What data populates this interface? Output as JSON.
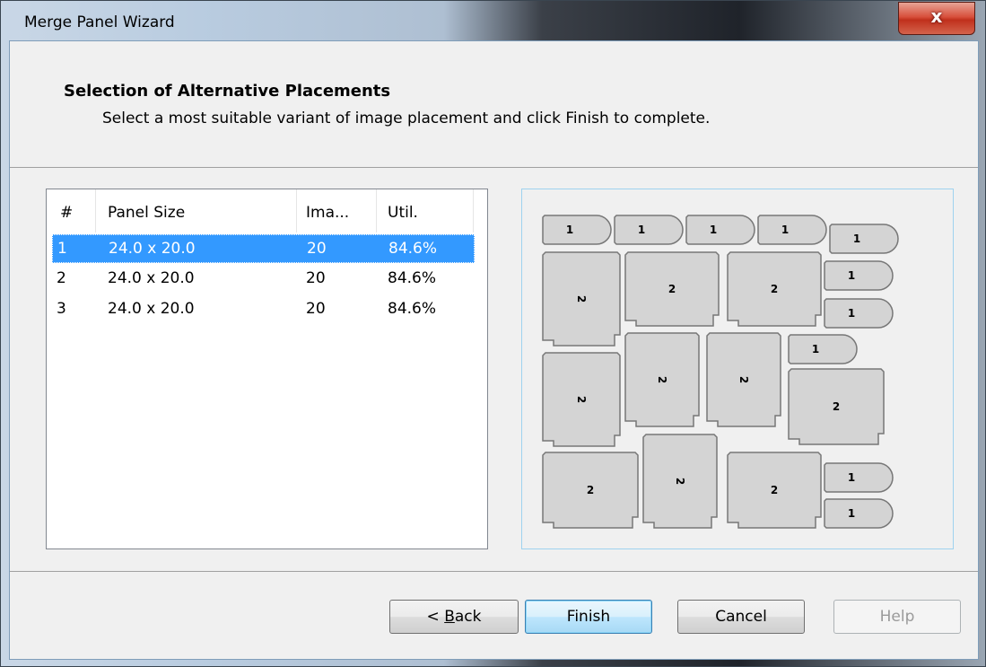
{
  "window": {
    "title": "Merge Panel Wizard",
    "close_glyph": "x"
  },
  "header": {
    "title": "Selection of Alternative Placements",
    "subtitle": "Select a most suitable variant of image placement and click Finish to complete."
  },
  "list": {
    "columns": [
      "#",
      "Panel Size",
      "Ima...",
      "Util."
    ],
    "rows": [
      {
        "num": "1",
        "panel_size": "24.0 x 20.0",
        "images": "20",
        "util": "84.6%",
        "selected": true
      },
      {
        "num": "2",
        "panel_size": "24.0 x 20.0",
        "images": "20",
        "util": "84.6%",
        "selected": false
      },
      {
        "num": "3",
        "panel_size": "24.0 x 20.0",
        "images": "20",
        "util": "84.6%",
        "selected": false
      }
    ]
  },
  "preview": {
    "piece_labels": [
      "1",
      "1",
      "1",
      "1",
      "1",
      "2",
      "2",
      "2",
      "1",
      "1",
      "2",
      "2",
      "2",
      "1",
      "2",
      "2",
      "2",
      "2",
      "1",
      "1"
    ]
  },
  "buttons": {
    "back_prefix": "< ",
    "back_mnemonic": "B",
    "back_rest": "ack",
    "finish": "Finish",
    "cancel": "Cancel",
    "help": "Help"
  },
  "colors": {
    "selection": "#3399ff",
    "piece_fill": "#d4d4d4",
    "piece_stroke": "#777777",
    "close": "#c7412a"
  }
}
